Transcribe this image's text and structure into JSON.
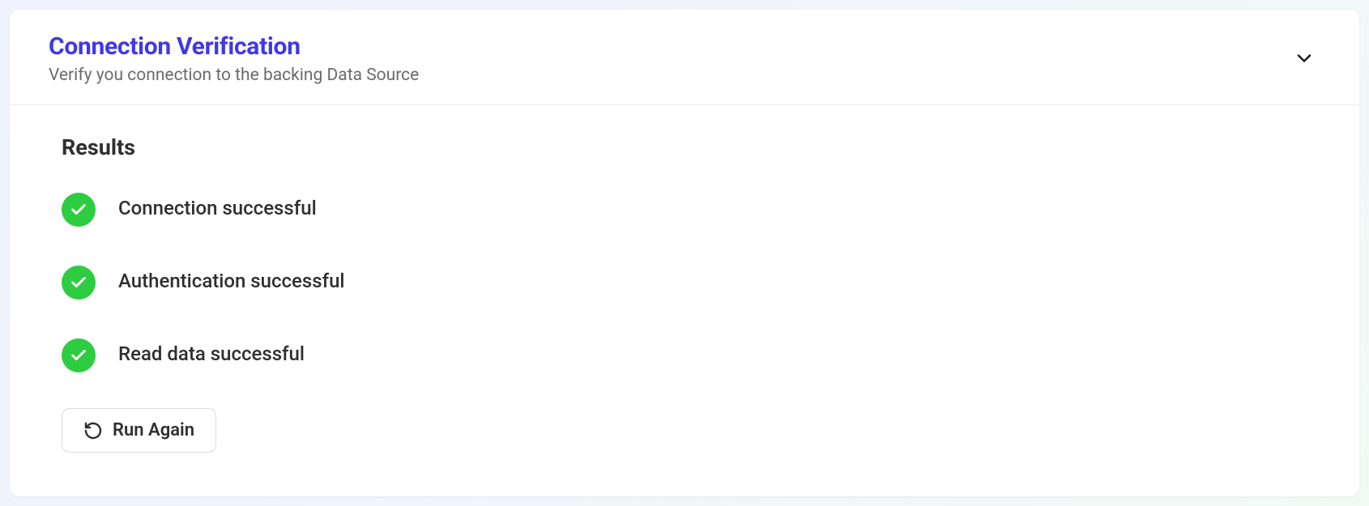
{
  "header": {
    "title": "Connection Verification",
    "subtitle": "Verify you connection to the backing Data Source"
  },
  "results": {
    "heading": "Results",
    "items": [
      {
        "label": "Connection successful"
      },
      {
        "label": "Authentication successful"
      },
      {
        "label": "Read data successful"
      }
    ]
  },
  "actions": {
    "run_again": "Run Again"
  },
  "colors": {
    "accent": "#4038e6",
    "success": "#2ecc40"
  }
}
